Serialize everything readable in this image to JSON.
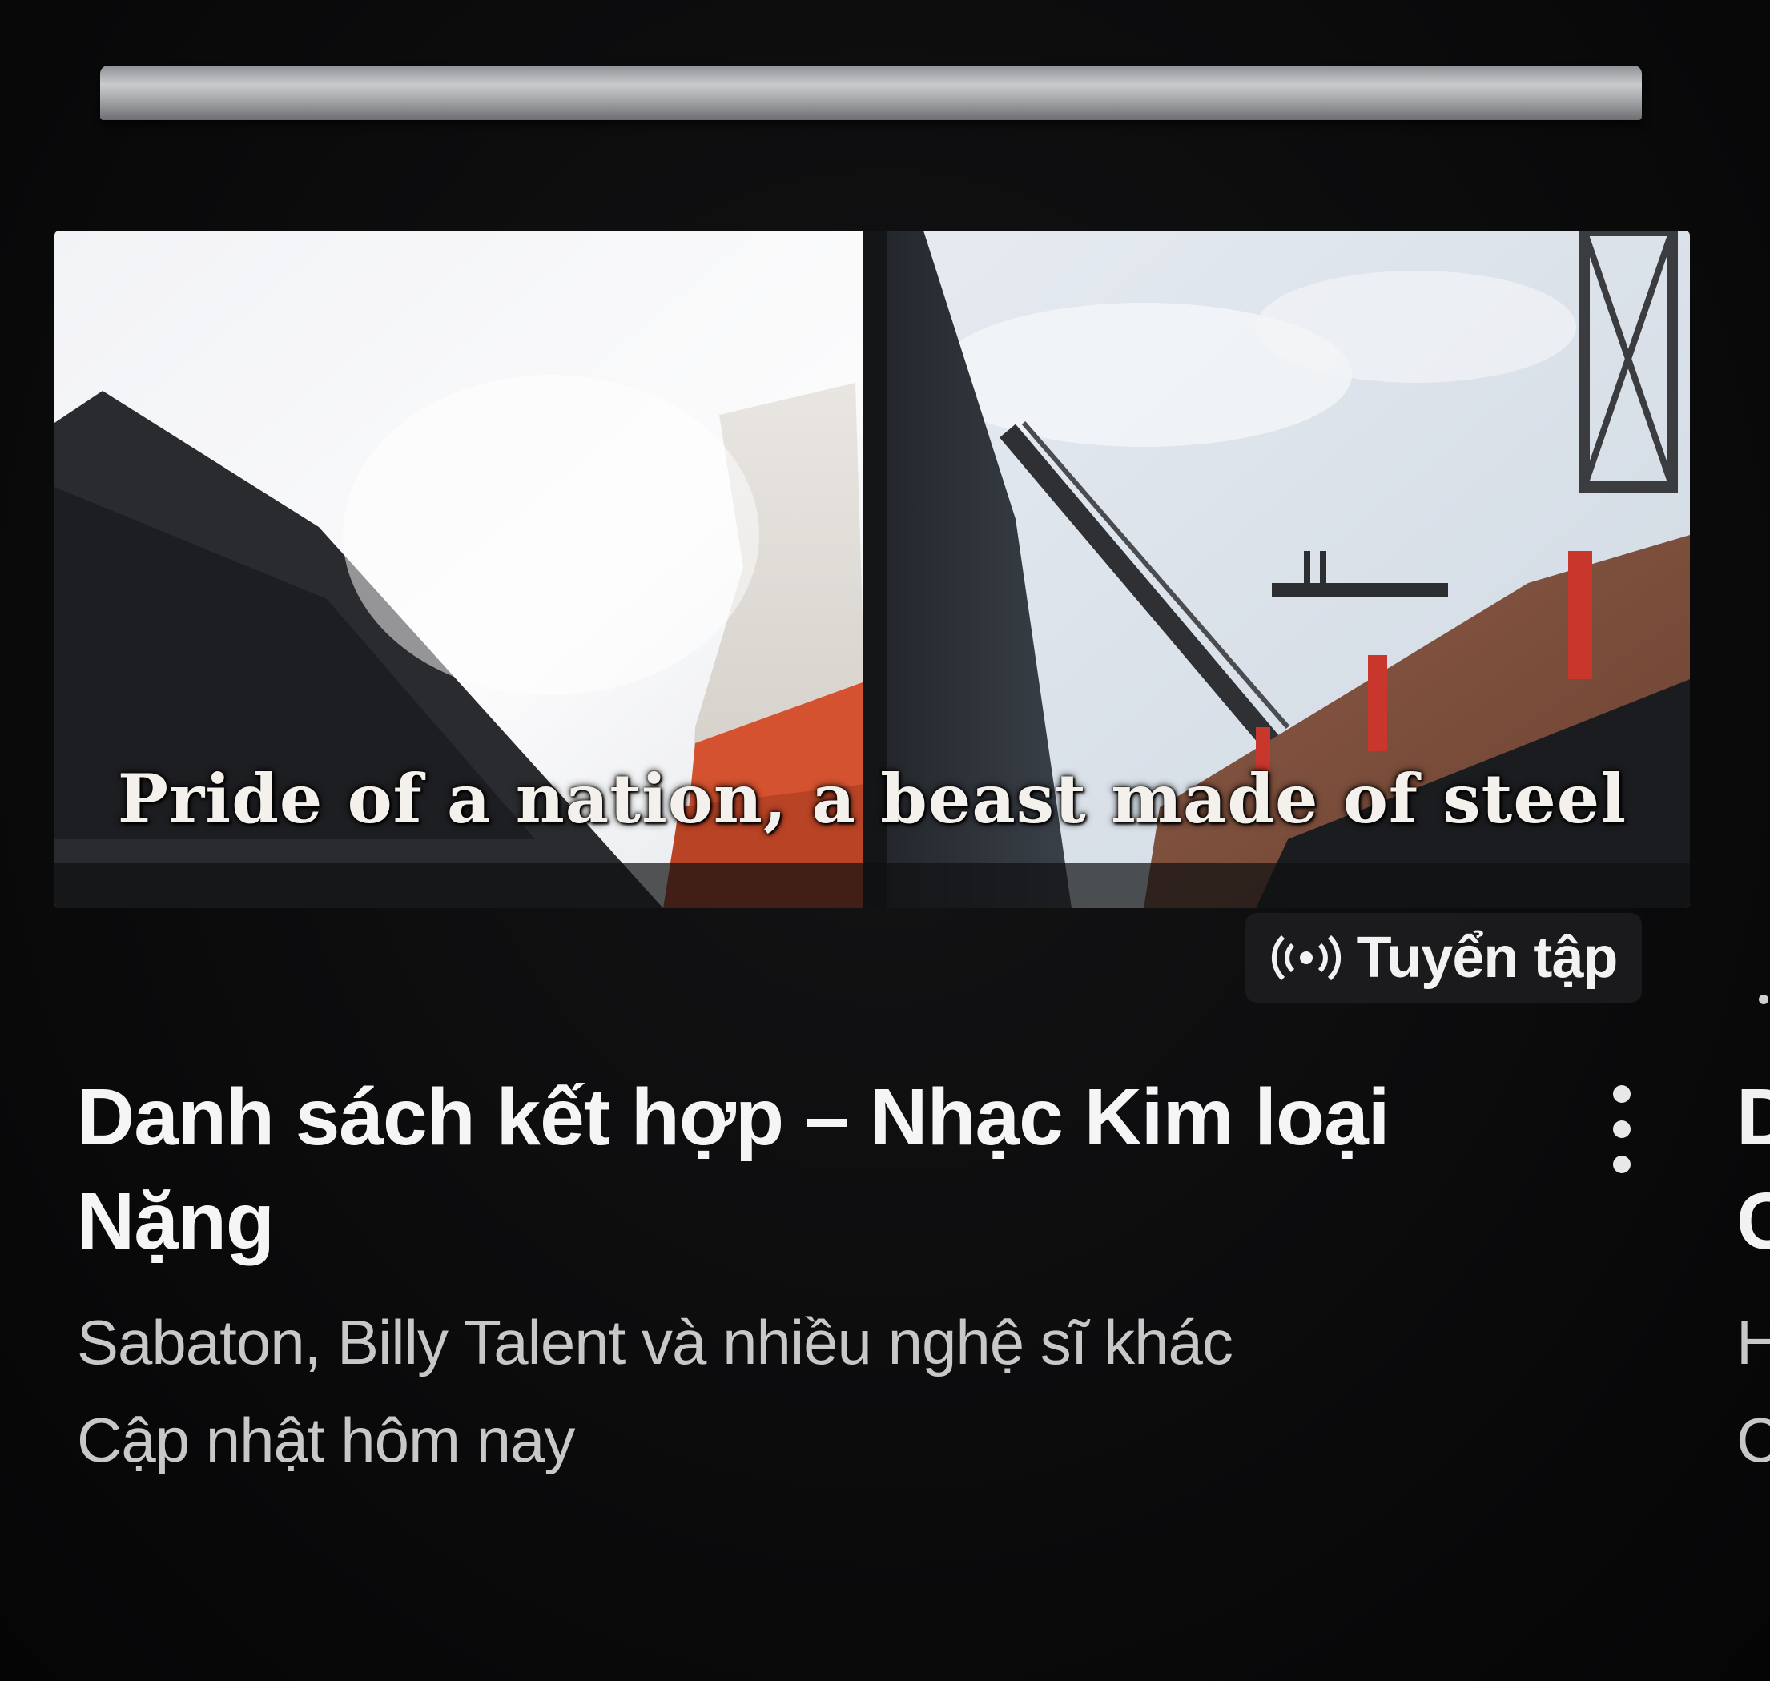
{
  "thumbnail": {
    "subtitle_text": "Pride of a nation, a beast made of steel"
  },
  "badge": {
    "icon": "broadcast-icon",
    "label": "Tuyển tập"
  },
  "card": {
    "title_line1": "Danh sách kết hợp – Nhạc Kim loại",
    "title_line2": "Nặng",
    "artists": "Sabaton, Billy Talent và nhiều nghệ sĩ khác",
    "updated": "Cập nhật hôm nay",
    "menu_icon": "more-vertical-icon"
  },
  "next_card": {
    "title_line1": "D",
    "title_line2": "C",
    "meta_line1": "H",
    "meta_line2": "C"
  }
}
